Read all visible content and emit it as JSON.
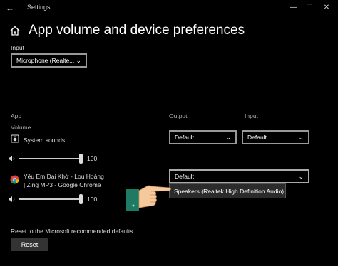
{
  "window": {
    "title": "Settings",
    "controls": [
      "—",
      "☐",
      "✕"
    ]
  },
  "page": {
    "title": "App volume and device preferences"
  },
  "input_section": {
    "label": "Input",
    "selected": "Microphone (Realte..."
  },
  "table": {
    "app_header": "App",
    "output_header": "Output",
    "input_header": "Input",
    "volume_label": "Volume"
  },
  "apps": [
    {
      "name": "System sounds",
      "volume_text": "100",
      "volume_level": 1.0,
      "output": "Default",
      "input": "Default"
    },
    {
      "name_line1": "Yêu Em Dại Khờ - Lou Hoàng",
      "name_line2": "| Zing MP3 - Google Chrome",
      "volume_text": "100",
      "volume_level": 1.0,
      "output": "Default"
    }
  ],
  "output_menu": {
    "options": [
      "Speakers (Realtek High Definition Audio)"
    ]
  },
  "reset": {
    "text": "Reset to the Microsoft recommended defaults.",
    "button_label": "Reset"
  },
  "colors": {
    "background": "#000000",
    "dropdown_border": "#999999",
    "menu_bg": "#2b2b2b",
    "hand_skin": "#f5c99b",
    "hand_cuff": "#1e7a63"
  }
}
